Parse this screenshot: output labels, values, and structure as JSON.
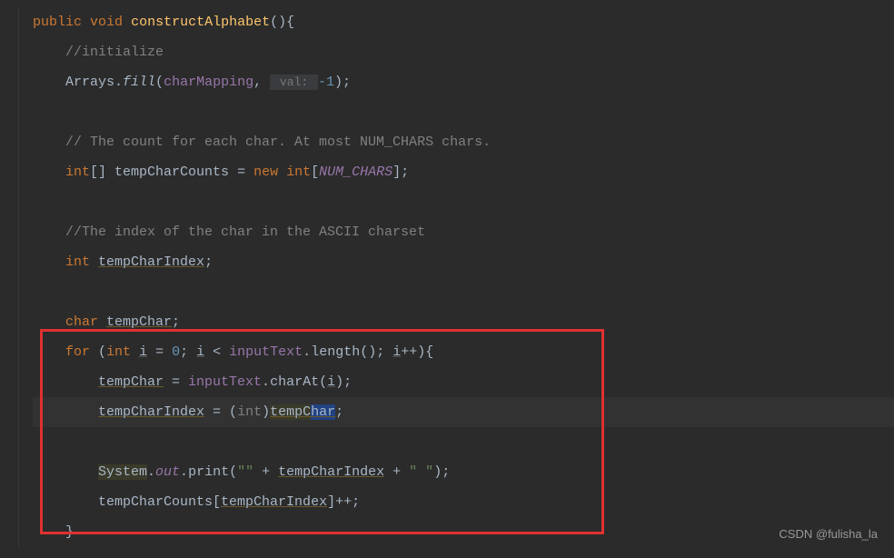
{
  "code": {
    "line1": {
      "public": "public",
      "void": "void",
      "method": "constructAlphabet",
      "parens": "(){"
    },
    "line2": {
      "comment": "//initialize"
    },
    "line3": {
      "arrays": "Arrays",
      "dot": ".",
      "fill": "fill",
      "open": "(",
      "field": "charMapping",
      "comma": ",",
      "hint": " val: ",
      "minus": "-",
      "one": "1",
      "close": ");"
    },
    "line5": {
      "comment": "// The count for each char. At most NUM_CHARS chars."
    },
    "line6": {
      "int": "int",
      "brackets": "[] ",
      "var": "tempCharCounts",
      "eq": " = ",
      "new": "new",
      "int2": " int",
      "open": "[",
      "const": "NUM_CHARS",
      "close": "];"
    },
    "line8": {
      "comment": "//The index of the char in the ASCII charset"
    },
    "line9": {
      "int": "int",
      "var": "tempCharIndex",
      "semi": ";"
    },
    "line11": {
      "char": "char",
      "var": "tempChar",
      "semi": ";"
    },
    "line12": {
      "for": "for",
      "open": " (",
      "int": "int",
      "i1": "i",
      "eq": " = ",
      "zero": "0",
      "semi1": "; ",
      "i2": "i",
      "lt": " < ",
      "input": "inputText",
      "dot": ".",
      "length": "length",
      "call": "(); ",
      "i3": "i",
      "inc": "++){"
    },
    "line13": {
      "var": "tempChar",
      "eq": " = ",
      "input": "inputText",
      "dot": ".",
      "charat": "charAt",
      "open": "(",
      "i": "i",
      "close": ");"
    },
    "line14": {
      "var": "tempCharIndex",
      "eq": " = ",
      "open": "(",
      "cast": "int",
      "close": ")",
      "tc1": "tempC",
      "tc2": "har",
      "semi": ";"
    },
    "line16": {
      "system": "System",
      "dot1": ".",
      "out": "out",
      "dot2": ".",
      "print": "print",
      "open": "(",
      "str1": "\"\"",
      "plus1": " + ",
      "var": "tempCharIndex",
      "plus2": " + ",
      "str2": "\" \"",
      "close": ");"
    },
    "line17": {
      "var": "tempCharCounts",
      "open": "[",
      "idx": "tempCharIndex",
      "close": "]",
      "inc": "++;"
    },
    "line18": {
      "brace": "}"
    }
  },
  "watermark": "CSDN @fulisha_la"
}
